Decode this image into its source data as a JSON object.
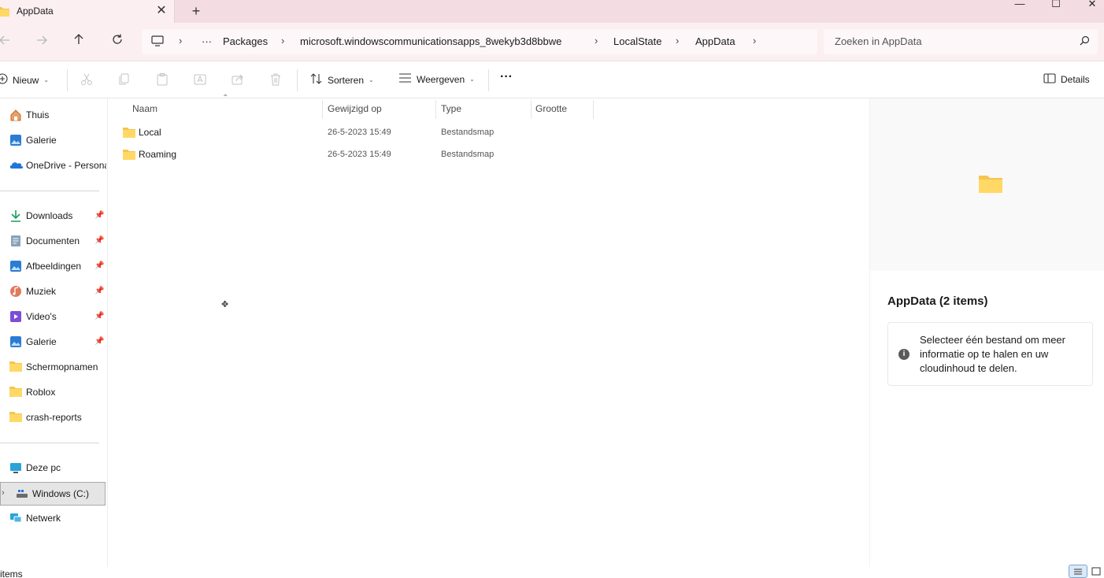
{
  "tab": {
    "title": "AppData",
    "close_glyph": "✕",
    "new_tab_glyph": "+"
  },
  "window_controls": {
    "minimize": "—",
    "maximize": "☐",
    "close": "✕"
  },
  "address": {
    "more": "···",
    "crumbs": [
      "Packages",
      "microsoft.windowscommunicationsapps_8wekyb3d8bbwe",
      "LocalState",
      "AppData"
    ],
    "search_placeholder": "Zoeken in AppData"
  },
  "commandbar": {
    "new_label": "Nieuw",
    "sort_label": "Sorteren",
    "view_label": "Weergeven",
    "more_label": "···",
    "details_label": "Details"
  },
  "sidebar": {
    "top": [
      {
        "label": "Thuis",
        "icon": "home-icon"
      },
      {
        "label": "Galerie",
        "icon": "gallery-icon"
      },
      {
        "label": "OneDrive - Persona",
        "icon": "onedrive-icon"
      }
    ],
    "pinned": [
      {
        "label": "Downloads",
        "icon": "download-icon"
      },
      {
        "label": "Documenten",
        "icon": "document-icon"
      },
      {
        "label": "Afbeeldingen",
        "icon": "pictures-icon"
      },
      {
        "label": "Muziek",
        "icon": "music-icon"
      },
      {
        "label": "Video's",
        "icon": "video-icon"
      },
      {
        "label": "Galerie",
        "icon": "gallery-icon"
      },
      {
        "label": "Schermopnamen",
        "icon": "folder-icon"
      },
      {
        "label": "Roblox",
        "icon": "folder-icon"
      },
      {
        "label": "crash-reports",
        "icon": "folder-icon"
      }
    ],
    "devices": [
      {
        "label": "Deze pc",
        "icon": "pc-icon"
      },
      {
        "label": "Windows (C:)",
        "icon": "drive-icon"
      },
      {
        "label": "Netwerk",
        "icon": "network-icon"
      }
    ]
  },
  "filelist": {
    "columns": [
      "Naam",
      "Gewijzigd op",
      "Type",
      "Grootte"
    ],
    "rows": [
      {
        "name": "Local",
        "modified": "26-5-2023 15:49",
        "type": "Bestandsmap"
      },
      {
        "name": "Roaming",
        "modified": "26-5-2023 15:49",
        "type": "Bestandsmap"
      }
    ]
  },
  "details": {
    "title": "AppData (2 items)",
    "info": "Selecteer één bestand om meer informatie op te halen en uw cloudinhoud te delen."
  },
  "status": {
    "text": "items"
  },
  "colors": {
    "titlebar": "#f3dde3",
    "navbar": "#fbeff2",
    "folder": "#f6c44f",
    "accent": "#0067c0"
  }
}
